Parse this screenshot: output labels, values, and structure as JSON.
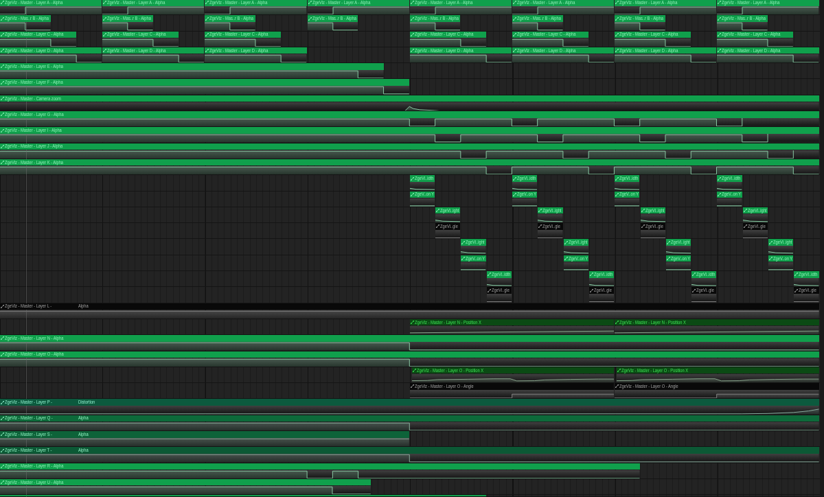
{
  "playlist": {
    "tracks": [
      {
        "clips": [
          {
            "label": "ZgeViz - Master - Layer A - Alpha",
            "color": "#10a04c"
          },
          {
            "label": "ZgeViz - Master - Layer A - Alpha",
            "color": "#10a04c"
          },
          {
            "label": "ZgeViz - Master - Layer A - Alpha",
            "color": "#10a04c"
          },
          {
            "label": "ZgeViz - Master - Layer A - Alpha",
            "color": "#10a04c"
          },
          {
            "label": "ZgeViz - Master - Layer A - Alpha",
            "color": "#10a04c"
          },
          {
            "label": "ZgeViz - Master - Layer A - Alpha",
            "color": "#10a04c"
          },
          {
            "label": "ZgeViz - Master - Layer A - Alpha",
            "color": "#10a04c"
          },
          {
            "label": "ZgeViz - Master - Layer A - Alpha",
            "color": "#10a04c"
          }
        ]
      },
      {
        "clips": [
          {
            "label": "ZgeViz - Mas..r B - Alpha",
            "color": "#10a04c"
          },
          {
            "label": "ZgeViz - Mas..r B - Alpha",
            "color": "#10a04c"
          },
          {
            "label": "ZgeViz - Mas..r B - Alpha",
            "color": "#10a04c"
          },
          {
            "label": "ZgeViz - Mas..r B - Alpha",
            "color": "#10a04c"
          },
          {
            "label": "ZgeViz - Mas..r B - Alpha",
            "color": "#10a04c"
          },
          {
            "label": "ZgeViz - Mas..r B - Alpha",
            "color": "#10a04c"
          },
          {
            "label": "ZgeViz - Mas..r B - Alpha",
            "color": "#10a04c"
          },
          {
            "label": "ZgeViz - Mas..r B - Alpha",
            "color": "#10a04c"
          }
        ]
      },
      {
        "clips": [
          {
            "label": "ZgeViz - Master - Layer C - Alpha",
            "color": "#10a04c"
          },
          {
            "label": "ZgeViz - Master - Layer C - Alpha",
            "color": "#10a04c"
          },
          {
            "label": "ZgeViz - Master - Layer C - Alpha",
            "color": "#10a04c"
          },
          {
            "label": "ZgeViz - Master - Layer C - Alpha",
            "color": "#10a04c"
          },
          {
            "label": "ZgeViz - Master - Layer C - Alpha",
            "color": "#10a04c"
          },
          {
            "label": "ZgeViz - Master - Layer C - Alpha",
            "color": "#10a04c"
          },
          {
            "label": "ZgeViz - Master - Layer C - Alpha",
            "color": "#10a04c"
          }
        ]
      },
      {
        "clips": [
          {
            "label": "ZgeViz - Master - Layer D - Alpha",
            "color": "#10a04c"
          },
          {
            "label": "ZgeViz - Master - Layer D - Alpha",
            "color": "#10a04c"
          },
          {
            "label": "ZgeViz - Master - Layer D - Alpha",
            "color": "#10a04c"
          },
          {
            "label": "ZgeViz - Master - Layer D - Alpha",
            "color": "#10a04c"
          },
          {
            "label": "ZgeViz - Master - Layer D - Alpha",
            "color": "#10a04c"
          },
          {
            "label": "ZgeViz - Master - Layer D - Alpha",
            "color": "#10a04c"
          },
          {
            "label": "ZgeViz - Master - Layer D - Alpha",
            "color": "#10a04c"
          }
        ]
      },
      {
        "clips": [
          {
            "label": "ZgeViz - Master - Layer E - Alpha",
            "color": "#10a04c"
          }
        ]
      },
      {
        "clips": [
          {
            "label": "ZgeViz - Master - Layer F - Alpha",
            "color": "#10a04c"
          }
        ]
      },
      {
        "clips": [
          {
            "label": "ZgeViz - Master - Camera zoom",
            "color": "#10a04c"
          }
        ]
      },
      {
        "clips": [
          {
            "label": "ZgeViz - Master - Layer G - Alpha",
            "color": "#10a04c"
          }
        ]
      },
      {
        "clips": [
          {
            "label": "ZgeViz - Master - Layer I - Alpha",
            "color": "#10a04c"
          }
        ]
      },
      {
        "clips": [
          {
            "label": "ZgeViz - Master - Layer J - Alpha",
            "color": "#10a04c"
          }
        ]
      },
      {
        "clips": [
          {
            "label": "ZgeViz - Master - Layer K - Alpha",
            "color": "#10a04c"
          }
        ]
      },
      {
        "clips": [
          {
            "label": "ZgeVi..idth",
            "color": "#10a04c"
          },
          {
            "label": "ZgeVi..idth",
            "color": "#10a04c"
          },
          {
            "label": "ZgeVi..idth",
            "color": "#10a04c"
          },
          {
            "label": "ZgeVi..idth",
            "color": "#10a04c"
          }
        ]
      },
      {
        "clips": [
          {
            "label": "ZgeV..on Y",
            "color": "#10a04c"
          },
          {
            "label": "ZgeV..on Y",
            "color": "#10a04c"
          },
          {
            "label": "ZgeV..on Y",
            "color": "#10a04c"
          },
          {
            "label": "ZgeV..on Y",
            "color": "#10a04c"
          }
        ]
      },
      {
        "clips": [
          {
            "label": "ZgeVi..ight",
            "color": "#10a04c"
          },
          {
            "label": "ZgeVi..ight",
            "color": "#10a04c"
          },
          {
            "label": "ZgeVi..ight",
            "color": "#10a04c"
          },
          {
            "label": "ZgeVi..ight",
            "color": "#10a04c"
          }
        ]
      },
      {
        "clips": [
          {
            "label": "ZgeVi..gle",
            "color": "#090909"
          },
          {
            "label": "ZgeVi..gle",
            "color": "#090909"
          },
          {
            "label": "ZgeVi..gle",
            "color": "#090909"
          },
          {
            "label": "ZgeVi..gle",
            "color": "#090909"
          }
        ]
      },
      {
        "clips": [
          {
            "label": "ZgeVi..ight",
            "color": "#10a04c"
          },
          {
            "label": "ZgeVi..ight",
            "color": "#10a04c"
          },
          {
            "label": "ZgeVi..ight",
            "color": "#10a04c"
          },
          {
            "label": "ZgeVi..ight",
            "color": "#10a04c"
          }
        ]
      },
      {
        "clips": [
          {
            "label": "ZgeV..on Y",
            "color": "#10a04c"
          },
          {
            "label": "ZgeV..on Y",
            "color": "#10a04c"
          },
          {
            "label": "ZgeV..on Y",
            "color": "#10a04c"
          },
          {
            "label": "ZgeV..on Y",
            "color": "#10a04c"
          }
        ]
      },
      {
        "clips": [
          {
            "label": "ZgeVi..idth",
            "color": "#10a04c"
          },
          {
            "label": "ZgeVi..idth",
            "color": "#10a04c"
          },
          {
            "label": "ZgeVi..idth",
            "color": "#10a04c"
          },
          {
            "label": "ZgeVi..idth",
            "color": "#10a04c"
          }
        ]
      },
      {
        "clips": [
          {
            "label": "ZgeVi..gle",
            "color": "#090909"
          },
          {
            "label": "ZgeVi..gle",
            "color": "#090909"
          },
          {
            "label": "ZgeVi..gle",
            "color": "#090909"
          },
          {
            "label": "ZgeVi..gle",
            "color": "#090909"
          }
        ]
      },
      {
        "clips": [
          {
            "label": "ZgeViz - Master - Layer L -",
            "suffix": "Alpha",
            "color": "#090909"
          }
        ]
      },
      {
        "clips": [
          {
            "label": "ZgeViz - Master - Layer N - Position X",
            "color": "#0b4a14"
          },
          {
            "label": "ZgeViz - Master - Layer N - Position X",
            "color": "#0b4a14"
          }
        ]
      },
      {
        "clips": [
          {
            "label": "ZgeViz - Master - Layer N - Alpha",
            "color": "#10a04c"
          }
        ]
      },
      {
        "clips": [
          {
            "label": "ZgeViz - Master - Layer O - Alpha",
            "color": "#10a04c"
          }
        ]
      },
      {
        "clips": [
          {
            "label": "ZgeViz - Master - Layer O - Position X",
            "color": "#0b4a14"
          },
          {
            "label": "ZgeViz - Master - Layer O - Position X",
            "color": "#0b4a14"
          }
        ]
      },
      {
        "clips": [
          {
            "label": "ZgeViz - Master - Layer O - Angle",
            "color": "#090909"
          },
          {
            "label": "ZgeViz - Master - Layer O - Angle",
            "color": "#090909"
          }
        ]
      },
      {
        "clips": [
          {
            "label": "ZgeViz - Master - Layer P -",
            "suffix": "Distortion",
            "color": "#0c5a3e"
          }
        ]
      },
      {
        "clips": [
          {
            "label": "ZgeViz - Master - Layer Q -",
            "suffix": "Alpha",
            "color": "#0d6a3a"
          }
        ]
      },
      {
        "clips": [
          {
            "label": "ZgeViz - Master - Layer S -",
            "suffix": "Alpha",
            "color": "#0d6339"
          }
        ]
      },
      {
        "clips": [
          {
            "label": "ZgeViz - Master - Layer T -",
            "suffix": "Alpha",
            "color": "#0c5935"
          }
        ]
      },
      {
        "clips": [
          {
            "label": "ZgeViz - Master - Layer R - Alpha",
            "color": "#10a04c"
          }
        ]
      },
      {
        "clips": [
          {
            "label": "ZgeViz - Master - Layer U - Alpha",
            "color": "#10a04c"
          }
        ]
      },
      {
        "clips": [
          {
            "color": "#10a04c"
          }
        ]
      }
    ]
  }
}
